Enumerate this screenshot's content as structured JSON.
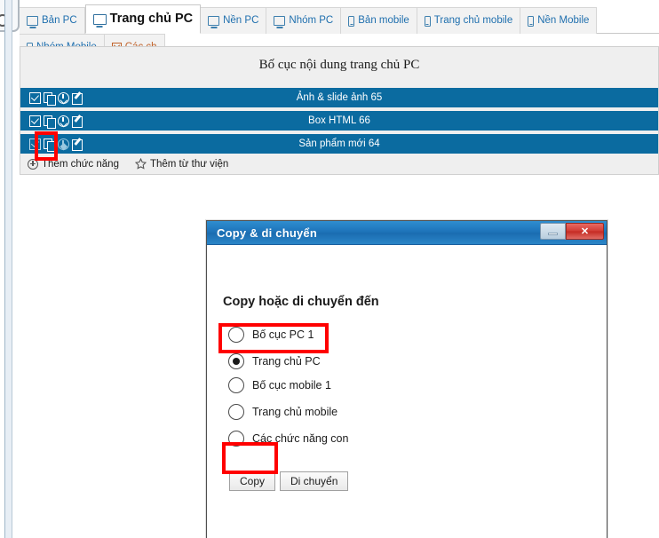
{
  "tabs": [
    {
      "label": "Bản PC",
      "icon": "monitor-icon",
      "active": false
    },
    {
      "label": "Trang chủ PC",
      "icon": "monitor-icon",
      "active": true
    },
    {
      "label": "Nền PC",
      "icon": "monitor-icon",
      "active": false
    },
    {
      "label": "Nhóm PC",
      "icon": "monitor-icon",
      "active": false
    },
    {
      "label": "Bản mobile",
      "icon": "phone-icon",
      "active": false
    },
    {
      "label": "Trang chủ mobile",
      "icon": "phone-icon",
      "active": false
    },
    {
      "label": "Nền Mobile",
      "icon": "phone-icon",
      "active": false
    },
    {
      "label": "Nhóm Mobile",
      "icon": "phone-icon",
      "active": false
    },
    {
      "label": "Các ch",
      "icon": "misc-icon",
      "active": false
    }
  ],
  "panel": {
    "title": "Bố cục nội dung trang chủ PC",
    "rows": [
      {
        "label": "Ảnh & slide ảnh 65",
        "icons": [
          "checkbox-checked-icon",
          "copy-icon",
          "cloud-download-icon",
          "edit-icon"
        ]
      },
      {
        "label": "Box HTML 66",
        "icons": [
          "checkbox-checked-icon",
          "copy-icon",
          "cloud-download-icon",
          "edit-icon"
        ]
      },
      {
        "label": "Sản phẩm mới 64",
        "icons": [
          "checkbox-checked-icon",
          "copy-icon",
          "cloud-download-icon",
          "edit-icon"
        ]
      }
    ],
    "actions": [
      {
        "label": "Thêm chức năng",
        "icon": "plus-circle-icon"
      },
      {
        "label": "Thêm từ thư viện",
        "icon": "star-icon"
      }
    ]
  },
  "dialog": {
    "title": "Copy & di chuyển",
    "heading": "Copy hoặc di chuyển đến",
    "minimize_label": "",
    "close_label": "✕",
    "options": [
      {
        "label": "Bố cục PC 1",
        "selected": false
      },
      {
        "label": "Trang chủ PC",
        "selected": true
      },
      {
        "label": "Bố cục mobile 1",
        "selected": false
      },
      {
        "label": "Trang chủ mobile",
        "selected": false
      },
      {
        "label": "Các chức năng con",
        "selected": false
      }
    ],
    "buttons": [
      {
        "label": "Copy"
      },
      {
        "label": "Di chuyển"
      }
    ]
  },
  "colors": {
    "row_blue": "#0b6ba0",
    "tab_link": "#1f6fae",
    "annotation_red": "#ff0000",
    "titlebar_blue": "#1d72b8",
    "close_red": "#d03a33"
  }
}
